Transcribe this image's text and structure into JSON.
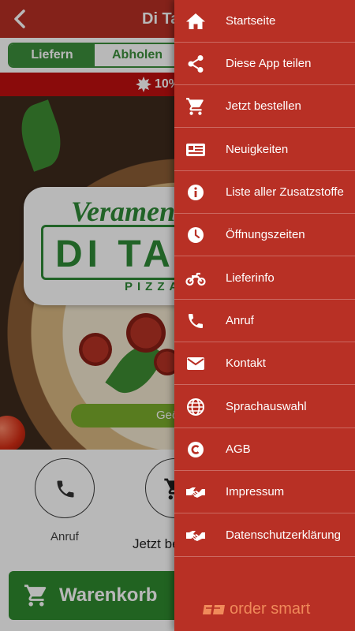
{
  "app": {
    "title": "Di Taco Pizza",
    "tabs": [
      {
        "label": "Liefern",
        "active": true
      },
      {
        "label": "Abholen",
        "active": false
      }
    ],
    "promo_text": "10%",
    "logo": {
      "script": "Veramente",
      "main": "DI TACO",
      "sub": "PIZZA"
    },
    "open_status": "Geöffnet",
    "actions": [
      {
        "label": "Anruf",
        "icon": "phone-icon"
      },
      {
        "label": "Jetzt bestellen",
        "icon": "cart-icon"
      }
    ],
    "cart_label": "Warenkorb"
  },
  "drawer": {
    "items": [
      {
        "label": "Startseite",
        "icon": "home-icon"
      },
      {
        "label": "Diese App teilen",
        "icon": "share-icon"
      },
      {
        "label": "Jetzt bestellen",
        "icon": "cart-icon"
      },
      {
        "label": "Neuigkeiten",
        "icon": "news-icon"
      },
      {
        "label": "Liste aller Zusatzstoffe",
        "icon": "info-icon"
      },
      {
        "label": "Öffnungszeiten",
        "icon": "clock-icon"
      },
      {
        "label": "Lieferinfo",
        "icon": "motorcycle-icon"
      },
      {
        "label": "Anruf",
        "icon": "phone-icon"
      },
      {
        "label": "Kontakt",
        "icon": "mail-icon"
      },
      {
        "label": "Sprachauswahl",
        "icon": "globe-icon"
      },
      {
        "label": "AGB",
        "icon": "copyright-icon"
      },
      {
        "label": "Impressum",
        "icon": "handshake-icon"
      },
      {
        "label": "Datenschutzerklärung",
        "icon": "handshake-icon"
      }
    ],
    "brand": "order smart"
  },
  "colors": {
    "primary": "#b83025",
    "green": "#3c8f3c",
    "brand_orange": "#f08a5a"
  }
}
